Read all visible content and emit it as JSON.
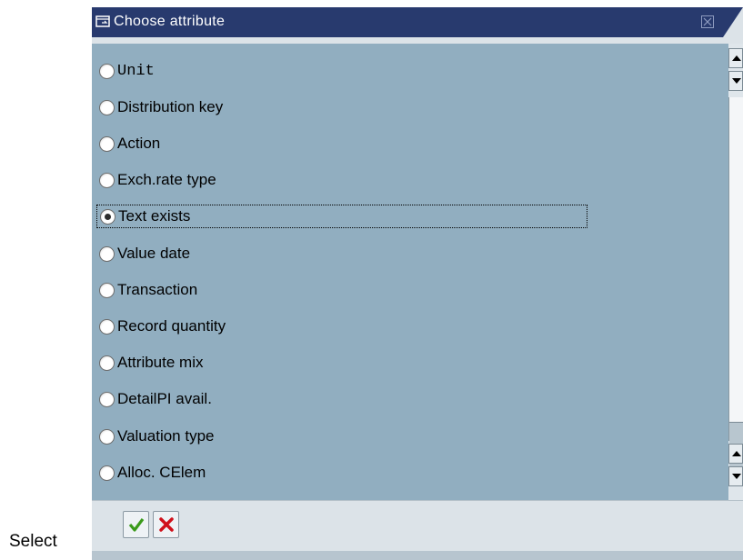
{
  "outside_label": "Select",
  "dialog": {
    "title": "Choose attribute",
    "options": [
      {
        "label": "Unit",
        "selected": false,
        "mono": true
      },
      {
        "label": "Distribution key",
        "selected": false
      },
      {
        "label": "Action",
        "selected": false
      },
      {
        "label": "Exch.rate type",
        "selected": false
      },
      {
        "label": "Text exists",
        "selected": true
      },
      {
        "label": "Value date",
        "selected": false
      },
      {
        "label": "Transaction",
        "selected": false
      },
      {
        "label": "Record quantity",
        "selected": false
      },
      {
        "label": "Attribute mix",
        "selected": false
      },
      {
        "label": "DetailPI avail.",
        "selected": false
      },
      {
        "label": "Valuation type",
        "selected": false
      },
      {
        "label": "Alloc. CElem",
        "selected": false
      }
    ]
  },
  "colors": {
    "title_bar": "#283a6e",
    "content_bg": "#91aec0",
    "confirm_check": "#3a9a1a",
    "cancel_x": "#d0101a"
  },
  "icons": {
    "title": "window-icon",
    "close": "close-icon",
    "confirm": "checkmark-icon",
    "cancel": "cancel-x-icon"
  }
}
